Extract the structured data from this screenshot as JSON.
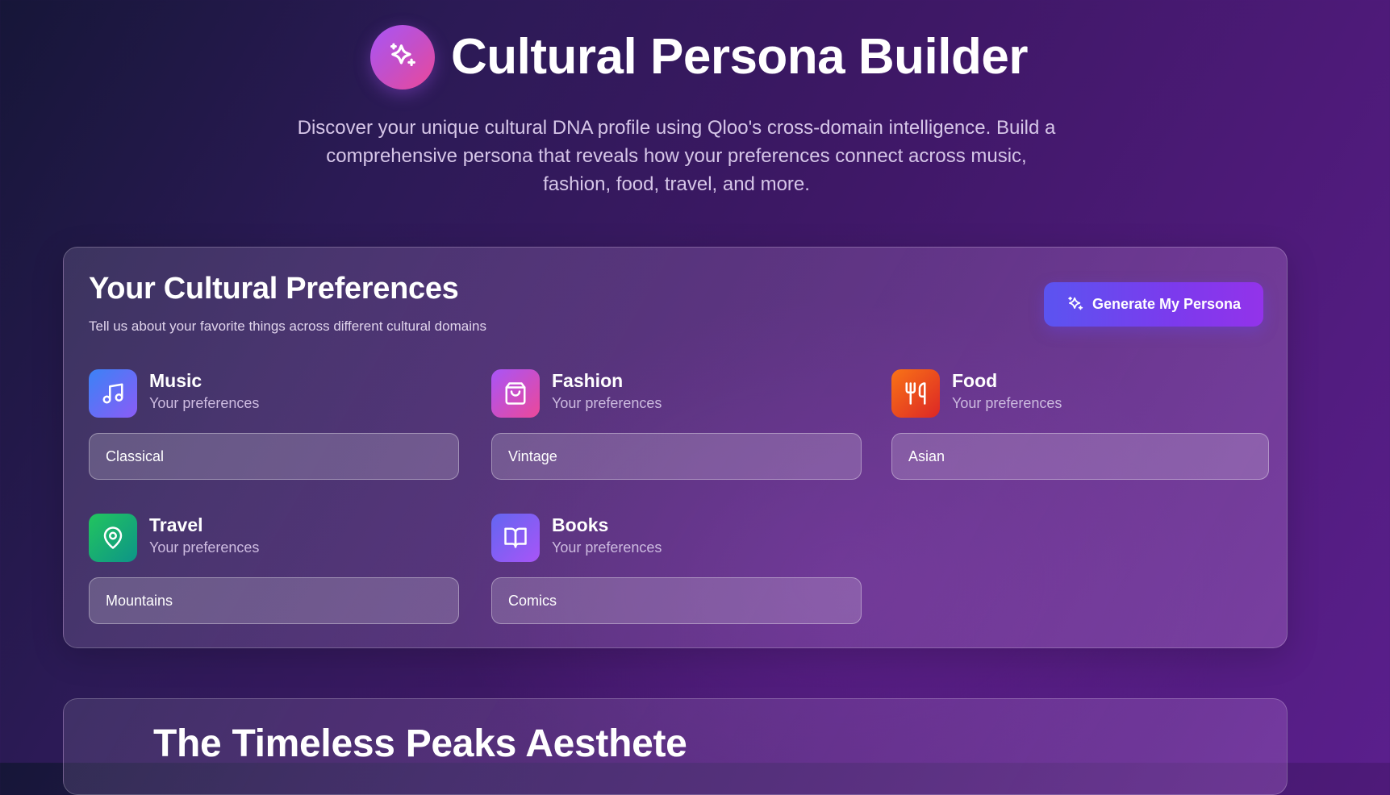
{
  "header": {
    "title": "Cultural Persona Builder",
    "logo_icon": "sparkles-icon",
    "subtitle": "Discover your unique cultural DNA profile using Qloo's cross-domain intelligence. Build a comprehensive persona that reveals how your preferences connect across music, fashion, food, travel, and more."
  },
  "preferences": {
    "title": "Your Cultural Preferences",
    "subtitle": "Tell us about your favorite things across different cultural domains",
    "generate_button": {
      "label": "Generate My Persona",
      "icon": "sparkles-icon"
    },
    "domains": [
      {
        "name": "Music",
        "hint": "Your preferences",
        "value": "Classical",
        "icon": "music-note-icon",
        "colors": [
          "#3b82f6",
          "#8b5cf6"
        ]
      },
      {
        "name": "Fashion",
        "hint": "Your preferences",
        "value": "Vintage",
        "icon": "shopping-bag-icon",
        "colors": [
          "#a855f7",
          "#ec4899"
        ]
      },
      {
        "name": "Food",
        "hint": "Your preferences",
        "value": "Asian",
        "icon": "utensils-icon",
        "colors": [
          "#f97316",
          "#dc2626"
        ]
      },
      {
        "name": "Travel",
        "hint": "Your preferences",
        "value": "Mountains",
        "icon": "map-pin-icon",
        "colors": [
          "#22c55e",
          "#0d9488"
        ]
      },
      {
        "name": "Books",
        "hint": "Your preferences",
        "value": "Comics",
        "icon": "book-open-icon",
        "colors": [
          "#6366f1",
          "#a855f7"
        ]
      }
    ]
  },
  "result": {
    "title": "The Timeless Peaks Aesthete"
  },
  "colors": {
    "accent": "#7c3aed",
    "background_dark": "#161638",
    "background_purple": "#5a1f8c"
  }
}
